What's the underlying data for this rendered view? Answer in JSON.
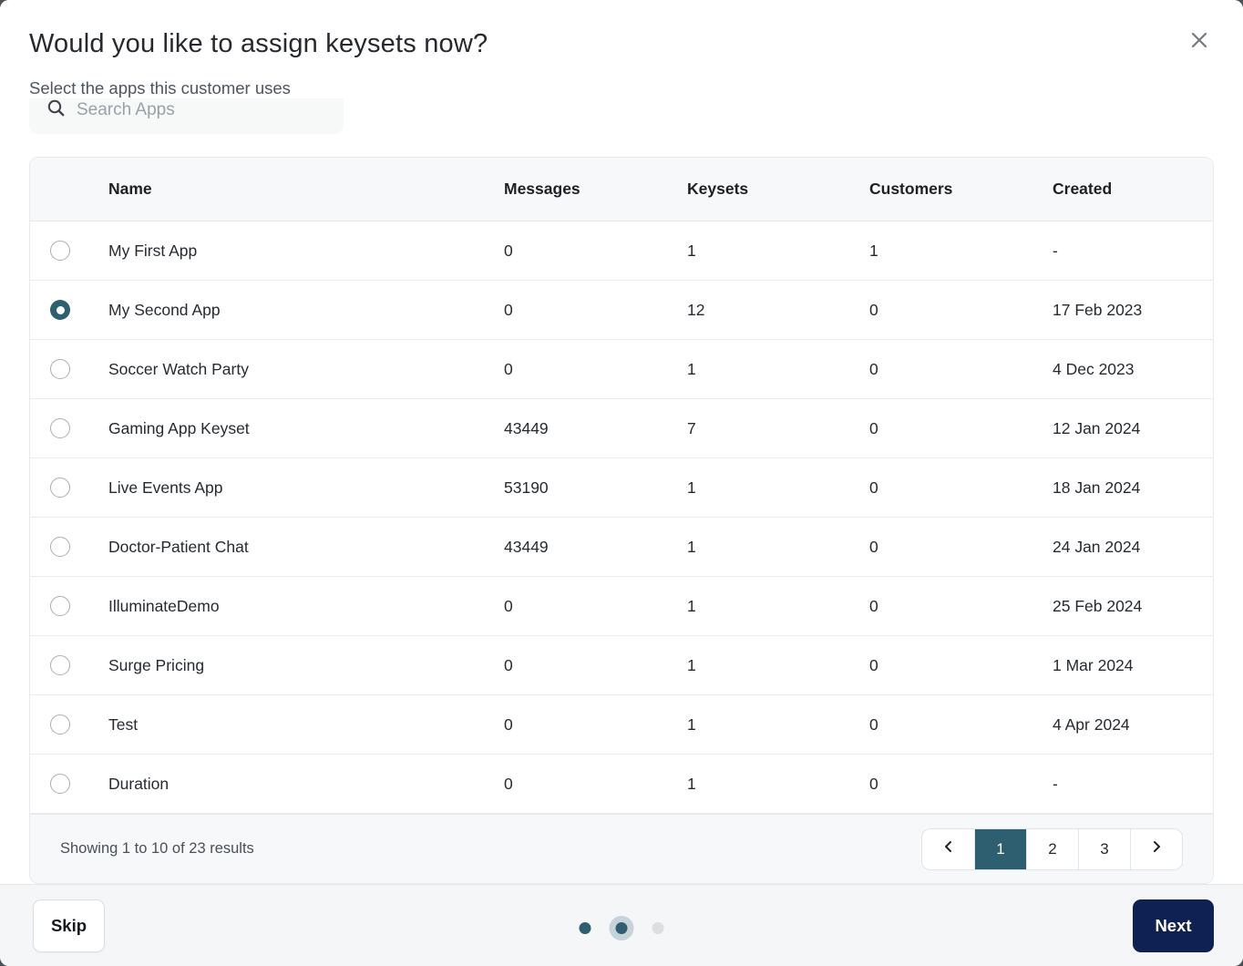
{
  "modal": {
    "title": "Would you like to assign keysets now?",
    "subtitle": "Select the apps this customer uses"
  },
  "search": {
    "placeholder": "Search Apps"
  },
  "table": {
    "columns": [
      "Name",
      "Messages",
      "Keysets",
      "Customers",
      "Created"
    ],
    "rows": [
      {
        "name": "My First App",
        "messages": "0",
        "keysets": "1",
        "customers": "1",
        "created": "-",
        "selected": false
      },
      {
        "name": "My Second App",
        "messages": "0",
        "keysets": "12",
        "customers": "0",
        "created": "17 Feb 2023",
        "selected": true
      },
      {
        "name": "Soccer Watch Party",
        "messages": "0",
        "keysets": "1",
        "customers": "0",
        "created": "4 Dec 2023",
        "selected": false
      },
      {
        "name": "Gaming App Keyset",
        "messages": "43449",
        "keysets": "7",
        "customers": "0",
        "created": "12 Jan 2024",
        "selected": false
      },
      {
        "name": "Live Events App",
        "messages": "53190",
        "keysets": "1",
        "customers": "0",
        "created": "18 Jan 2024",
        "selected": false
      },
      {
        "name": "Doctor-Patient Chat",
        "messages": "43449",
        "keysets": "1",
        "customers": "0",
        "created": "24 Jan 2024",
        "selected": false
      },
      {
        "name": "IlluminateDemo",
        "messages": "0",
        "keysets": "1",
        "customers": "0",
        "created": "25 Feb 2024",
        "selected": false
      },
      {
        "name": "Surge Pricing",
        "messages": "0",
        "keysets": "1",
        "customers": "0",
        "created": "1 Mar 2024",
        "selected": false
      },
      {
        "name": "Test",
        "messages": "0",
        "keysets": "1",
        "customers": "0",
        "created": "4 Apr 2024",
        "selected": false
      },
      {
        "name": "Duration",
        "messages": "0",
        "keysets": "1",
        "customers": "0",
        "created": "-",
        "selected": false
      }
    ],
    "footer": {
      "summary": "Showing 1 to 10 of 23 results",
      "pagination": {
        "pages": [
          "1",
          "2",
          "3"
        ],
        "active": "1"
      }
    }
  },
  "footer_bar": {
    "skip_label": "Skip",
    "next_label": "Next",
    "steps": {
      "count": 3,
      "current": 2
    }
  },
  "icons": {
    "close": "close-icon",
    "search": "search-icon",
    "prev": "chevron-left-icon",
    "next": "chevron-right-icon"
  },
  "colors": {
    "accent_teal": "#2e5f70",
    "accent_navy": "#0e2152",
    "table_band_bg": "#f7f8f9",
    "footer_bar_bg": "#f5f6f8",
    "border": "#e8ebee",
    "step_halo": "#c6d4da",
    "inactive_dot": "#dcdee1"
  }
}
